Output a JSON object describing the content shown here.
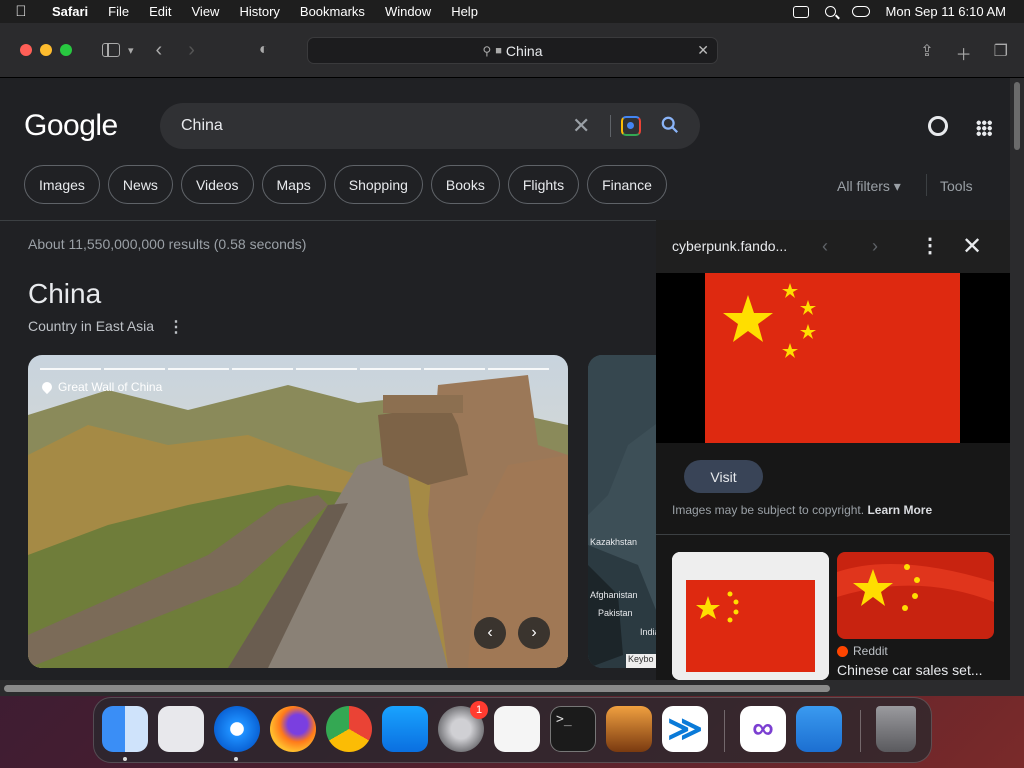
{
  "menubar": {
    "app": "Safari",
    "items": [
      "File",
      "Edit",
      "View",
      "History",
      "Bookmarks",
      "Window",
      "Help"
    ],
    "datetime": "Mon Sep 11  6:10 AM"
  },
  "toolbar": {
    "url": "China"
  },
  "google": {
    "logo": "Google",
    "query": "China",
    "chips": [
      "Images",
      "News",
      "Videos",
      "Maps",
      "Shopping",
      "Books",
      "Flights",
      "Finance"
    ],
    "all_filters": "All filters",
    "tools": "Tools",
    "stats": "About 11,550,000,000 results (0.58 seconds)"
  },
  "knowledge_panel": {
    "title": "China",
    "subtitle": "Country in East Asia",
    "hero_location": "Great Wall of China",
    "map_labels": [
      "Kazakhstan",
      "Afghanistan",
      "Pakistan",
      "India"
    ],
    "map_attribution": "Keybo"
  },
  "image_panel": {
    "source": "cyberpunk.fando...",
    "visit_label": "Visit",
    "copyright_text": "Images may be subject to copyright.",
    "learn_more": "Learn More",
    "related_source": "Reddit",
    "related_title": "Chinese car sales set..."
  },
  "dock": {
    "apps": [
      "finder",
      "launchpad",
      "safari",
      "firefox",
      "chrome",
      "app-store",
      "system-settings",
      "textedit",
      "terminal",
      "garageband",
      "vscode",
      "visual-studio",
      "weather",
      "trash"
    ],
    "settings_badge": "1"
  },
  "colors": {
    "page_bg": "#202124",
    "chip_border": "#5f6368",
    "flag_red": "#de2910",
    "flag_yellow": "#ffde00",
    "visit_button": "#394457"
  }
}
